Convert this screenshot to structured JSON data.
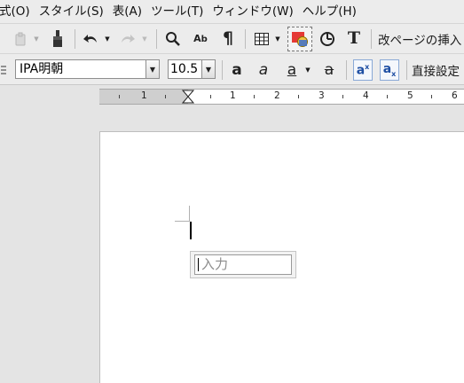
{
  "menubar": {
    "items": [
      "式(O)",
      "スタイル(S)",
      "表(A)",
      "ツール(T)",
      "ウィンドウ(W)",
      "ヘルプ(H)"
    ]
  },
  "toolbar1": {
    "insert_page_break_label": "改ページの挿入"
  },
  "toolbar2": {
    "font_name": "IPA明朝",
    "font_size": "10.5",
    "direct_format_label": "直接設定"
  },
  "ruler": {
    "labels": [
      "1",
      "1",
      "2",
      "3",
      "4",
      "5",
      "6"
    ]
  },
  "ime": {
    "placeholder": "入力"
  }
}
